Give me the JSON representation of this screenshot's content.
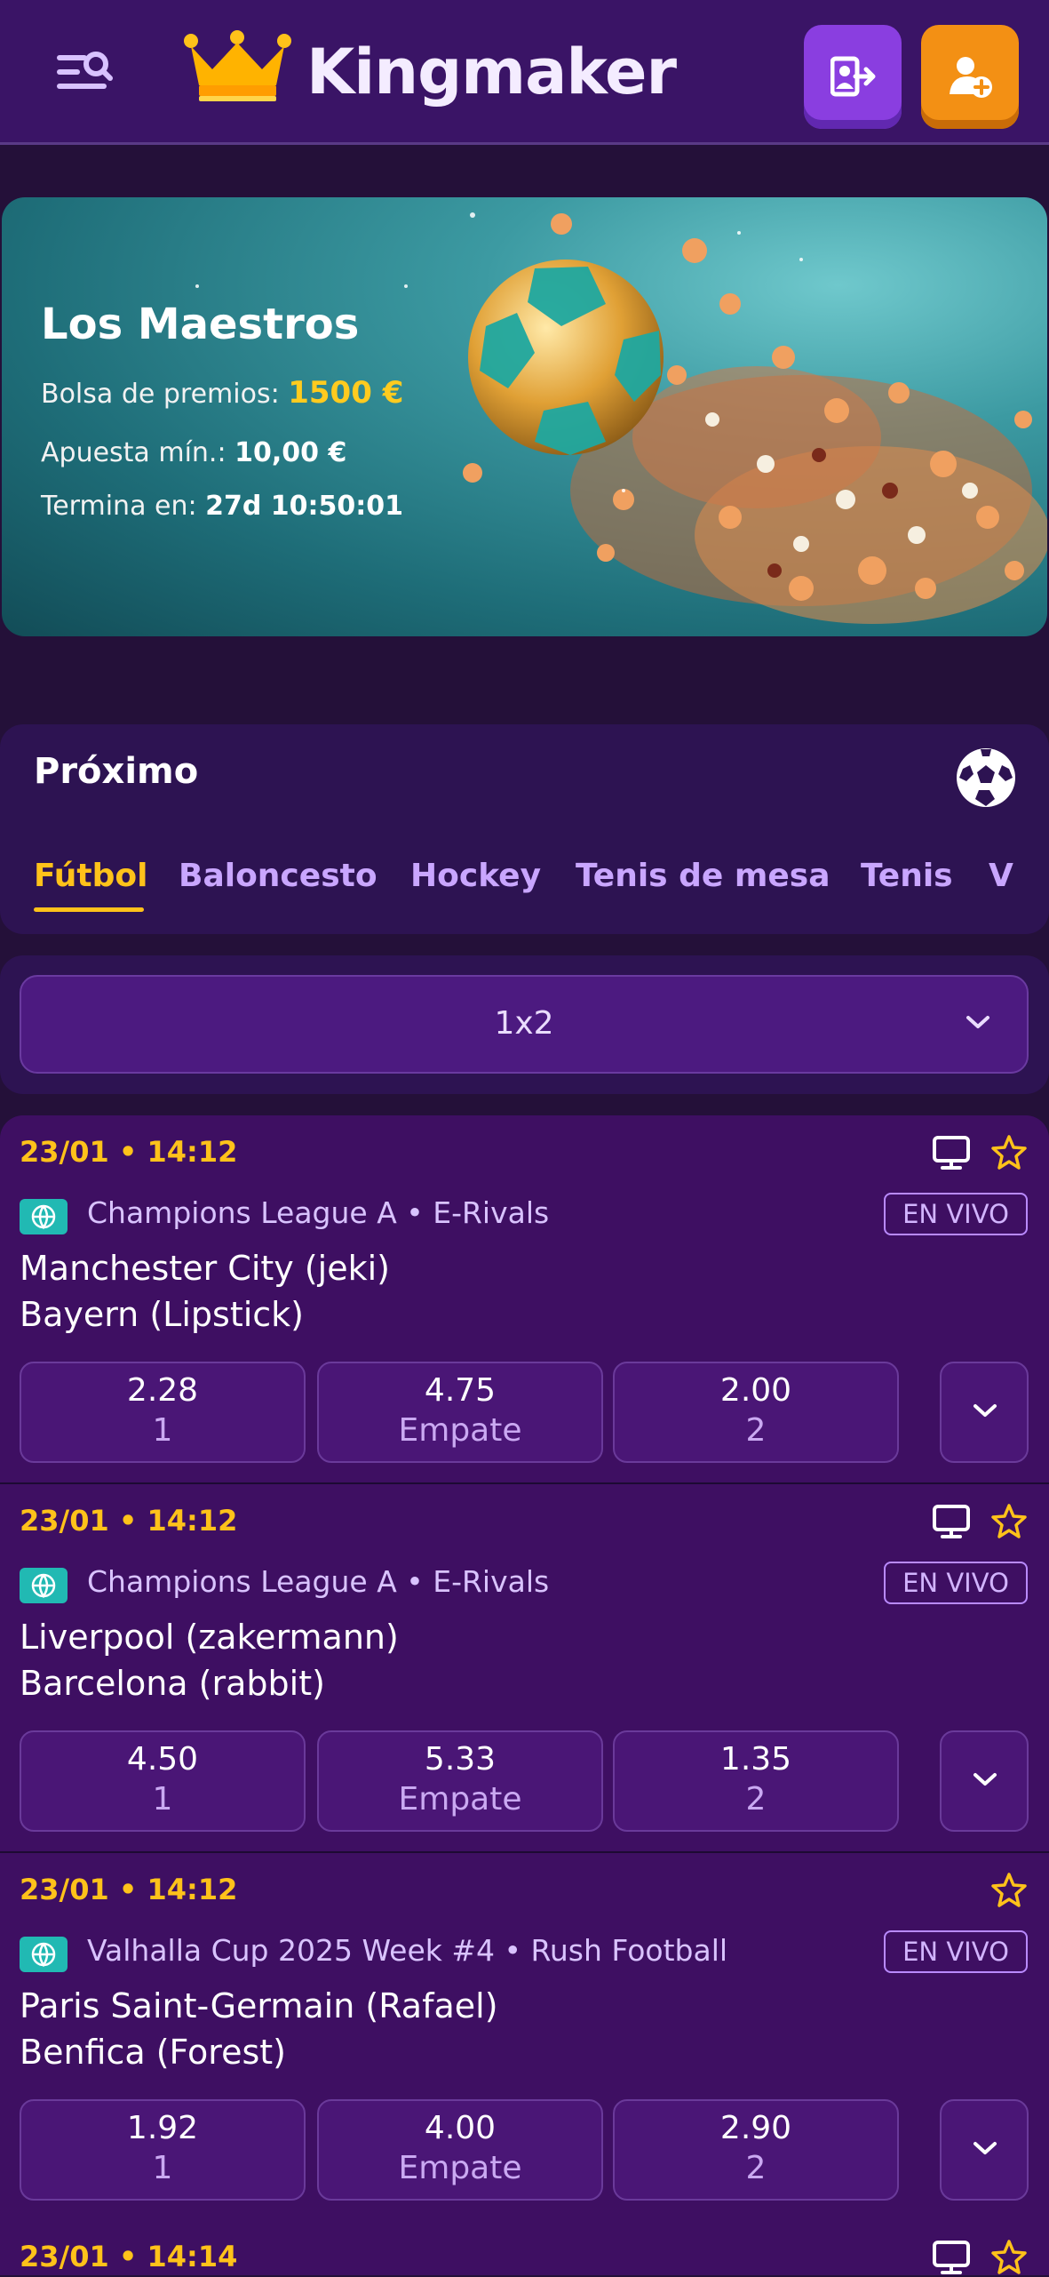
{
  "header": {
    "brand": "Kingmaker",
    "menu_icon": "menu-search-icon",
    "login_icon": "login-icon",
    "signup_icon": "add-user-icon",
    "colors": {
      "bg": "#3a1466",
      "login": "#8a3ee0",
      "signup": "#f39014"
    }
  },
  "promo": {
    "title": "Los Maestros",
    "pool_label": "Bolsa de premios:",
    "pool_value": "1500 €",
    "min_bet_label": "Apuesta mín.:",
    "min_bet_value": "10,00 €",
    "ends_label": "Termina en:",
    "ends_value": "27d 10:50:01"
  },
  "upcoming": {
    "title": "Próximo",
    "tabs": [
      {
        "label": "Fútbol",
        "active": true
      },
      {
        "label": "Baloncesto"
      },
      {
        "label": "Hockey"
      },
      {
        "label": "Tenis de mesa"
      },
      {
        "label": "Tenis"
      },
      {
        "label": "V"
      }
    ]
  },
  "market": {
    "selected": "1x2"
  },
  "matches": [
    {
      "date": "23/01 • 14:12",
      "league": "Champions League A • E-Rivals",
      "live": "EN VIVO",
      "team1": "Manchester City (jeki)",
      "team2": "Bayern (Lipstick)",
      "odds": [
        {
          "value": "2.28",
          "label": "1"
        },
        {
          "value": "4.75",
          "label": "Empate"
        },
        {
          "value": "2.00",
          "label": "2"
        }
      ],
      "has_stream": true
    },
    {
      "date": "23/01 • 14:12",
      "league": "Champions League A • E-Rivals",
      "live": "EN VIVO",
      "team1": "Liverpool (zakermann)",
      "team2": "Barcelona (rabbit)",
      "odds": [
        {
          "value": "4.50",
          "label": "1"
        },
        {
          "value": "5.33",
          "label": "Empate"
        },
        {
          "value": "1.35",
          "label": "2"
        }
      ],
      "has_stream": true
    },
    {
      "date": "23/01 • 14:12",
      "league": "Valhalla Cup 2025 Week #4 • Rush Football",
      "live": "EN VIVO",
      "team1": "Paris Saint-Germain (Rafael)",
      "team2": "Benfica (Forest)",
      "odds": [
        {
          "value": "1.92",
          "label": "1"
        },
        {
          "value": "4.00",
          "label": "Empate"
        },
        {
          "value": "2.90",
          "label": "2"
        }
      ],
      "has_stream": false
    },
    {
      "date": "23/01 • 14:14",
      "has_stream": true
    }
  ]
}
